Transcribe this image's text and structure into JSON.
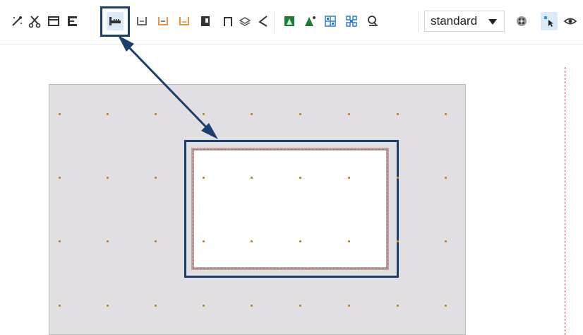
{
  "toolbar": {
    "tools": [
      {
        "icon": "magic-wand-icon"
      },
      {
        "icon": "scissors-icon"
      },
      {
        "icon": "window-frame-icon"
      },
      {
        "icon": "bracket-icon"
      },
      {
        "icon": "anchor-comb-icon",
        "active": true
      },
      {
        "icon": "profile-u-icon"
      },
      {
        "icon": "profile-u-orange-icon"
      },
      {
        "icon": "profile-u-orange-2-icon"
      },
      {
        "icon": "flag-block-icon"
      },
      {
        "icon": "arch-icon"
      },
      {
        "icon": "layers-icon"
      },
      {
        "icon": "angle-icon"
      },
      {
        "icon": "green-triangle-box-icon"
      },
      {
        "icon": "green-mountain-icon"
      },
      {
        "icon": "blue-grid-icon"
      },
      {
        "icon": "blue-nodes-icon"
      },
      {
        "icon": "search-zoom-icon"
      },
      {
        "icon": "checker-pattern-icon"
      },
      {
        "icon": "pointer-select-icon",
        "active": true
      },
      {
        "icon": "eye-icon"
      }
    ],
    "view_mode": {
      "selected": "standard"
    }
  },
  "colors": {
    "highlight": "#1b3f6e",
    "canvas": "#e1dfe1",
    "grid_point": "#c0842d",
    "guide_line": "#c2403f"
  }
}
